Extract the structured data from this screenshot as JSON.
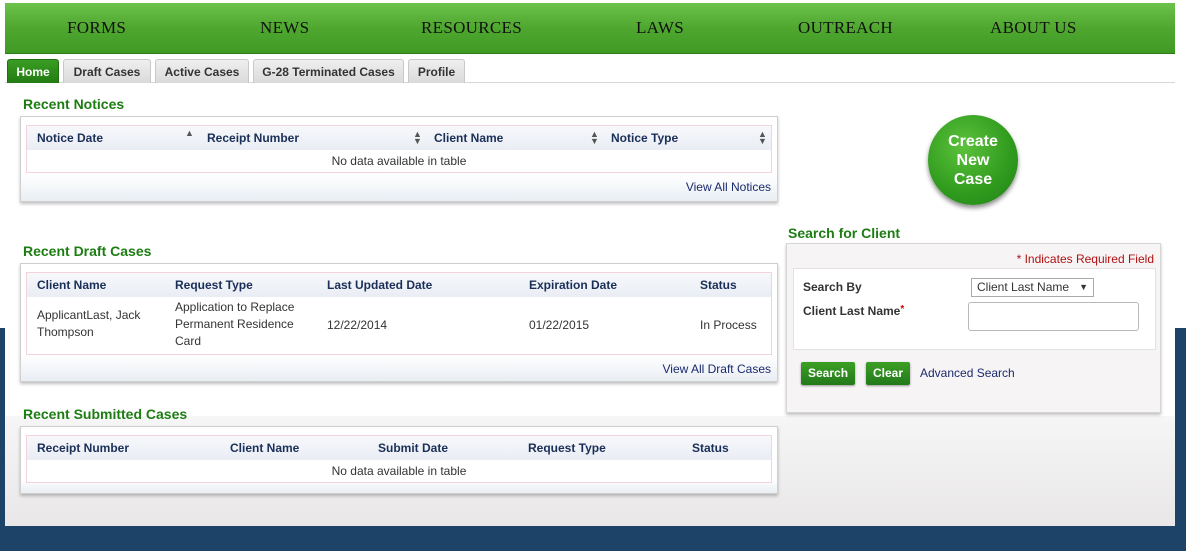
{
  "nav": {
    "items": [
      "FORMS",
      "NEWS",
      "RESOURCES",
      "LAWS",
      "OUTREACH",
      "ABOUT US"
    ]
  },
  "tabs": [
    {
      "label": "Home",
      "active": true
    },
    {
      "label": "Draft Cases",
      "active": false
    },
    {
      "label": "Active Cases",
      "active": false
    },
    {
      "label": "G-28 Terminated Cases",
      "active": false
    },
    {
      "label": "Profile",
      "active": false
    }
  ],
  "notices": {
    "title": "Recent Notices",
    "columns": [
      "Notice Date",
      "Receipt Number",
      "Client Name",
      "Notice Type"
    ],
    "empty_text": "No data available in table",
    "view_all": "View All Notices"
  },
  "drafts": {
    "title": "Recent Draft Cases",
    "columns": [
      "Client Name",
      "Request Type",
      "Last Updated Date",
      "Expiration Date",
      "Status"
    ],
    "rows": [
      {
        "client_name": "ApplicantLast, Jack Thompson",
        "request_type": "Application to Replace Permanent Residence Card",
        "last_updated": "12/22/2014",
        "expiration": "01/22/2015",
        "status": "In Process"
      }
    ],
    "view_all": "View All Draft Cases"
  },
  "submitted": {
    "title": "Recent Submitted Cases",
    "columns": [
      "Receipt Number",
      "Client Name",
      "Submit Date",
      "Request Type",
      "Status"
    ],
    "empty_text": "No data available in table"
  },
  "create_case": {
    "label": "Create New Case"
  },
  "search": {
    "title": "Search for Client",
    "required_note": "* Indicates Required Field",
    "search_by_label": "Search By",
    "search_by_value": "Client Last Name",
    "last_name_label": "Client Last Name",
    "last_name_value": "",
    "search_button": "Search",
    "clear_button": "Clear",
    "advanced_link": "Advanced Search"
  },
  "colors": {
    "accent_green": "#1d7d13",
    "nav_green": "#4fa72f",
    "page_navy": "#1d4468"
  }
}
